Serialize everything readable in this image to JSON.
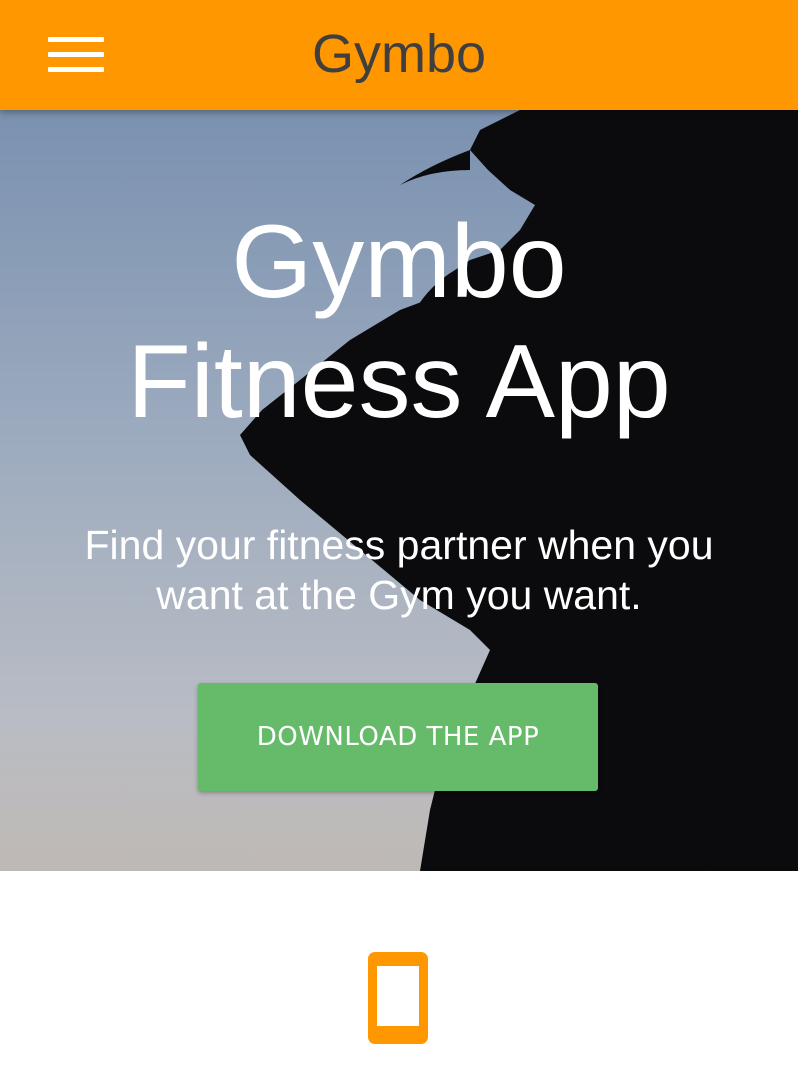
{
  "navbar": {
    "brand": "Gymbo",
    "menu_icon": "hamburger-menu-icon",
    "color": "#ff9800"
  },
  "hero": {
    "title_line1": "Gymbo",
    "title_line2": "Fitness App",
    "subtitle": "Find your fitness partner when you want at the Gym you want.",
    "cta_label": "DOWNLOAD THE APP",
    "cta_color": "#66bb6a",
    "background": "photo-silhouette-of-woman-against-sky"
  },
  "features": {
    "icon": "smartphone-icon",
    "icon_color": "#ff9800"
  }
}
